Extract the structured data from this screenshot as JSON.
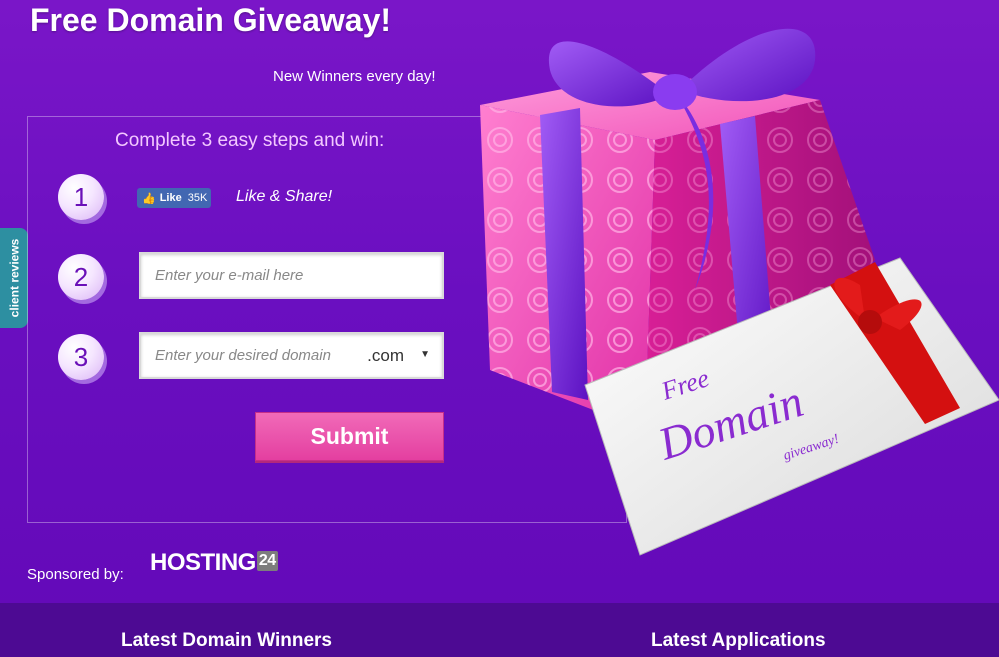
{
  "header": {
    "title": "Free Domain Giveaway!",
    "subtitle": "New Winners every day!"
  },
  "side_tab": {
    "label": "client reviews"
  },
  "steps": {
    "heading": "Complete 3 easy steps and win:",
    "items": [
      {
        "number": "1",
        "fb_like_label": "Like",
        "fb_like_count": "35K",
        "text": "Like & Share!"
      },
      {
        "number": "2",
        "placeholder": "Enter your e-mail here"
      },
      {
        "number": "3",
        "placeholder": "Enter your desired domain",
        "tld_selected": ".com"
      }
    ],
    "submit_label": "Submit"
  },
  "sponsor": {
    "label": "Sponsored by:",
    "logo_text": "HOSTING",
    "logo_badge": "24"
  },
  "illustration": {
    "envelope_line1": "Free",
    "envelope_line2": "Domain",
    "envelope_line3": "giveaway!"
  },
  "footer": {
    "left_heading": "Latest Domain Winners",
    "right_heading": "Latest Applications"
  },
  "colors": {
    "background": "#6a0fc0",
    "accent_pink": "#e43fa0",
    "tab_teal": "#2d8fa1",
    "facebook_blue": "#4267b2"
  }
}
